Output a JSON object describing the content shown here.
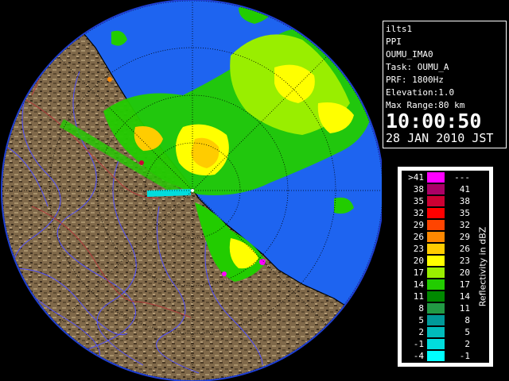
{
  "info": {
    "lines": [
      "ilts1",
      "PPI",
      "OUMU_IMA0",
      "Task: OUMU_A",
      "PRF: 1800Hz",
      "Elevation:1.0",
      "Max Range:80 km"
    ],
    "time": "10:00:50",
    "date": "28 JAN 2010 JST"
  },
  "legend": {
    "unit_label": "Reflectivity in dBZ",
    "rows": [
      {
        "lo": ">41",
        "hi": "---",
        "color": "#ff00ff"
      },
      {
        "lo": "38",
        "hi": "41",
        "color": "#aa0066"
      },
      {
        "lo": "35",
        "hi": "38",
        "color": "#cc0033"
      },
      {
        "lo": "32",
        "hi": "35",
        "color": "#ff0000"
      },
      {
        "lo": "29",
        "hi": "32",
        "color": "#ff4400"
      },
      {
        "lo": "26",
        "hi": "29",
        "color": "#ff8800"
      },
      {
        "lo": "23",
        "hi": "26",
        "color": "#ffcc00"
      },
      {
        "lo": "20",
        "hi": "23",
        "color": "#ffff00"
      },
      {
        "lo": "17",
        "hi": "20",
        "color": "#99ee00"
      },
      {
        "lo": "14",
        "hi": "17",
        "color": "#22cc00"
      },
      {
        "lo": "11",
        "hi": "14",
        "color": "#008800"
      },
      {
        "lo": "8",
        "hi": "11",
        "color": "#229944"
      },
      {
        "lo": "5",
        "hi": "8",
        "color": "#009999"
      },
      {
        "lo": "2",
        "hi": "5",
        "color": "#00bbbb"
      },
      {
        "lo": "-1",
        "hi": "2",
        "color": "#00dddd"
      },
      {
        "lo": "-4",
        "hi": "-1",
        "color": "#00ffff"
      }
    ]
  },
  "map_colors": {
    "sea": "#1e64f0",
    "outside_range": "#1f3fd2",
    "land": "#7d6a4e",
    "land_dark": "#3b2e1f",
    "rivers": "#4a4aff",
    "boundaries": "#b03a3a",
    "range_rings": "#000000"
  }
}
